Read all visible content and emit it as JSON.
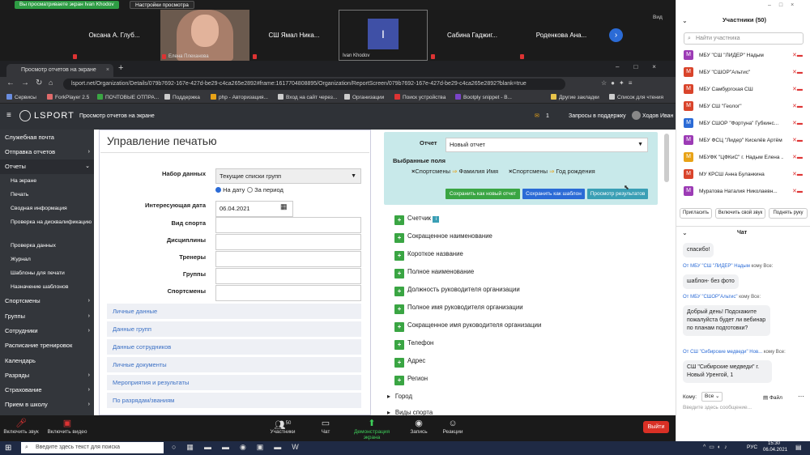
{
  "zoom_top": {
    "share_notice": "Вы просматриваете экран Ivan Khodov",
    "view_settings": "Настройки просмотра",
    "view_label": "Вид"
  },
  "gallery": [
    {
      "name": "Оксана А. Глуб..."
    },
    {
      "name": "Елена Плеханова",
      "label": "Елена Плеханова"
    },
    {
      "name": "СШ Ямал Ника..."
    },
    {
      "name": "I",
      "label": "Ivan Khodov"
    },
    {
      "name": "Сабина Гаджиг..."
    },
    {
      "name": "Роденкова Ана..."
    }
  ],
  "browser": {
    "tab_title": "Просмотр отчетов на экране",
    "url": "lsport.net/Organization/Details/079b7692-167e-427d-be29-c4ca265e2892#frame:1617704808895/Organization/ReportScreen/079b7692-167e-427d-be29-c4ca265e2892?blank=true",
    "bookmarks": [
      "Сервисы",
      "ForkPlayer 2.5",
      "ПОЧТОВЫЕ ОТПРА...",
      "Поддержка",
      "php - Авторизация...",
      "Вход на сайт через...",
      "Организации",
      "Поиск устройства",
      "Bootply snippet - B...",
      "Другие закладки",
      "Список для чтения"
    ]
  },
  "app": {
    "logo": "LSPORT",
    "page_title": "Просмотр отчетов на экране",
    "mail_count": "1",
    "support": "Запросы в поддержку",
    "user": "Ходов Иван"
  },
  "sidebar": [
    {
      "label": "Служебная почта",
      "sub": false
    },
    {
      "label": "Отправка отчетов",
      "sub": false,
      "arrow": "›"
    },
    {
      "label": "Отчеты",
      "sub": false,
      "arrow": "⌄"
    },
    {
      "label": "На экране",
      "sub": true
    },
    {
      "label": "Печать",
      "sub": true
    },
    {
      "label": "Сводная информация",
      "sub": true
    },
    {
      "label": "Проверка на дисквалификацию",
      "sub": true
    },
    {
      "label": "Проверка данных",
      "sub": true
    },
    {
      "label": "Журнал",
      "sub": true
    },
    {
      "label": "Шаблоны для печати",
      "sub": true
    },
    {
      "label": "Назначение шаблонов",
      "sub": true
    },
    {
      "label": "Спортсмены",
      "sub": false,
      "arrow": "›"
    },
    {
      "label": "Группы",
      "sub": false,
      "arrow": "›"
    },
    {
      "label": "Сотрудники",
      "sub": false,
      "arrow": "›"
    },
    {
      "label": "Расписание тренировок",
      "sub": false
    },
    {
      "label": "Календарь",
      "sub": false
    },
    {
      "label": "Разряды",
      "sub": false,
      "arrow": "›"
    },
    {
      "label": "Страхование",
      "sub": false,
      "arrow": "›"
    },
    {
      "label": "Прием в школу",
      "sub": false,
      "arrow": "›"
    }
  ],
  "print": {
    "heading": "Управление печатью",
    "dataset_label": "Набор данных",
    "dataset_value": "Текущие списки групп",
    "radio_date": "На дату",
    "radio_period": "За период",
    "date_label": "Интересующая дата",
    "date_value": "06.04.2021",
    "fields": [
      "Вид спорта",
      "Дисциплины",
      "Тренеры",
      "Группы",
      "Спортсмены"
    ],
    "accordions": [
      "Личные данные",
      "Данные групп",
      "Данные сотрудников",
      "Личные документы",
      "Мероприятия и результаты",
      "По разрядам/званиям"
    ]
  },
  "report": {
    "report_label": "Отчет",
    "report_value": "Новый отчет",
    "selected_label": "Выбранные поля",
    "chips": [
      {
        "a": "Спортсмены",
        "b": "Фамилия Имя"
      },
      {
        "a": "Спортсмены",
        "b": "Год рождения"
      }
    ],
    "btn_save_new": "Сохранить как новый отчет",
    "btn_save_tpl": "Сохранить как шаблон",
    "btn_preview": "Просмотр результатов",
    "fields": [
      "Счетчик",
      "Сокращенное наименование",
      "Короткое название",
      "Полное наименование",
      "Должность руководителя организации",
      "Полное имя руководителя организации",
      "Сокращенное имя руководителя организации",
      "Телефон",
      "Адрес",
      "Регион"
    ],
    "groups": [
      "Город",
      "Виды спорта"
    ]
  },
  "zoom_panel": {
    "participants_title": "Участники (50)",
    "search_placeholder": "Найти участника",
    "participants": [
      {
        "letter": "М",
        "color": "#9c3bb5",
        "name": "МБУ \"СШ \"ЛИДЕР\" Надым"
      },
      {
        "letter": "М",
        "color": "#d9442b",
        "name": "МБУ \"СШОР\"Альтис\""
      },
      {
        "letter": "М",
        "color": "#d9442b",
        "name": "МБУ Самбургская СШ"
      },
      {
        "letter": "М",
        "color": "#d9442b",
        "name": "МБУ СШ \"Геолог\""
      },
      {
        "letter": "М",
        "color": "#2b6bd6",
        "name": "МБУ СШОР \"Фортуна\" Губкинс..."
      },
      {
        "letter": "М",
        "color": "#9c3bb5",
        "name": "МБУ ФСЦ \"Лидер\" Киселёв Артём"
      },
      {
        "letter": "М",
        "color": "#e8a317",
        "name": "МБУФК \"ЦФКиС\" г. Надым Елена ..."
      },
      {
        "letter": "М",
        "color": "#d9442b",
        "name": "МУ КРСШ Анна Буланкина"
      },
      {
        "letter": "М",
        "color": "#9c3bb5",
        "name": "Муратова Наталия Николаевн..."
      }
    ],
    "btn_invite": "Пригласить",
    "btn_unmute": "Включить свой звук",
    "btn_hand": "Поднять руку",
    "chat_title": "Чат",
    "messages": [
      {
        "from": "",
        "text": "спасибо!"
      },
      {
        "from": "От МБУ \"СШ \"ЛИДЕР\" Надым",
        "to": "кому Все:",
        "text": "шаблон- без фото"
      },
      {
        "from": "От МБУ \"СШОР\"Альтис\"",
        "to": "кому Все:",
        "text": "Добрый день! Подскажите пожалуйста будет ли вебинар по планам подготовки?"
      },
      {
        "from": "От СШ \"Сибирские медведи\" Нов...",
        "to": "кому Все:",
        "text": "СШ \"Сибирские медведи\" г. Новый Уренгой, 1"
      }
    ],
    "to_label": "Кому:",
    "to_value": "Все",
    "file_label": "Файл",
    "input_placeholder": "Введите здесь сообщение..."
  },
  "zoom_bar": {
    "audio": "Включить звук",
    "video": "Включить видео",
    "participants": "Участники",
    "participants_count": "50",
    "chat": "Чат",
    "share": "Демонстрация экрана",
    "record": "Запись",
    "reactions": "Реакции",
    "leave": "Выйти"
  },
  "taskbar": {
    "search": "Введите здесь текст для поиска",
    "lang": "РУС",
    "time": "15:30",
    "date": "06.04.2021"
  }
}
